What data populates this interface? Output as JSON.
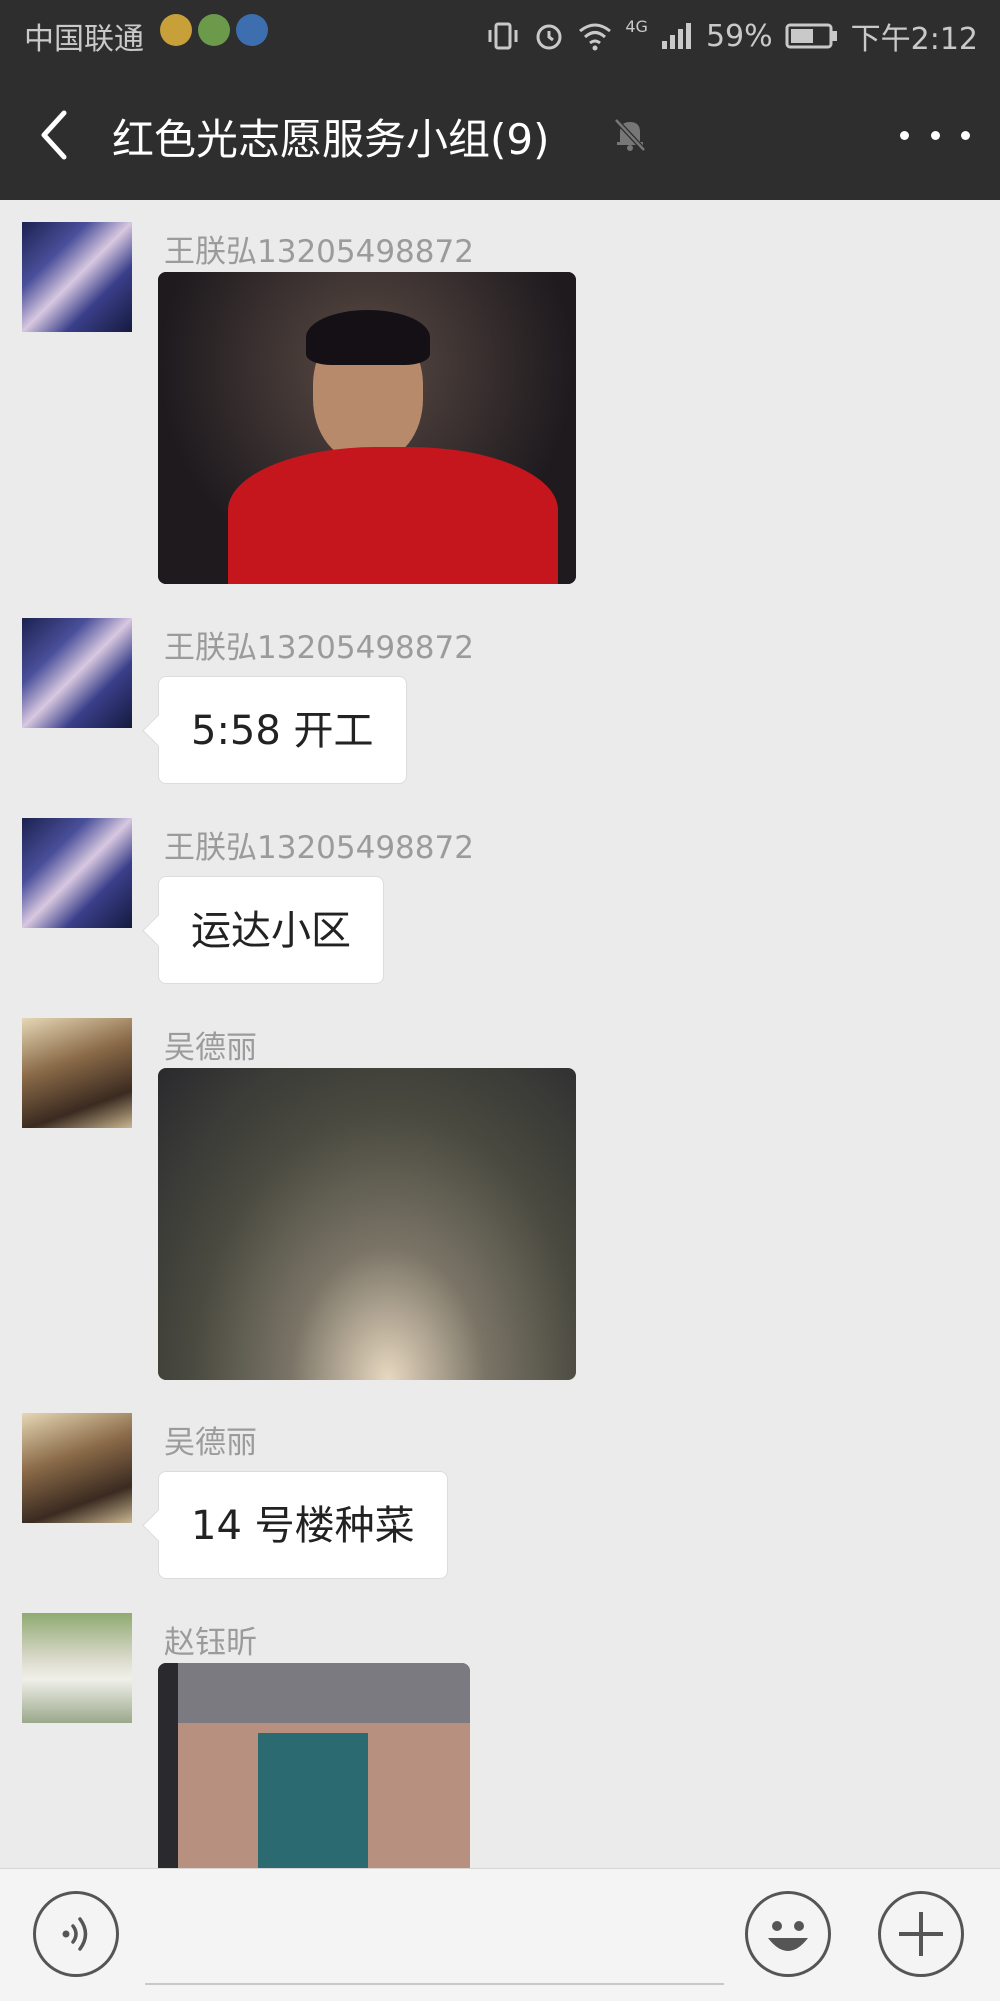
{
  "status_bar": {
    "carrier": "中国联通",
    "network": "4G",
    "battery": "59%",
    "time": "下午2:12"
  },
  "header": {
    "title": "红色光志愿服务小组(9)"
  },
  "messages": [
    {
      "sender": "王朕弘13205498872",
      "type": "image",
      "avatar": "anime-avatar"
    },
    {
      "sender": "王朕弘13205498872",
      "type": "text",
      "text": "5:58 开工",
      "avatar": "anime-avatar"
    },
    {
      "sender": "王朕弘13205498872",
      "type": "text",
      "text": "运达小区",
      "avatar": "anime-avatar"
    },
    {
      "sender": "吴德丽",
      "type": "image",
      "avatar": "couple-avatar"
    },
    {
      "sender": "吴德丽",
      "type": "text",
      "text": "14 号楼种菜",
      "avatar": "couple-avatar"
    },
    {
      "sender": "赵钰昕",
      "type": "image",
      "avatar": "umbrella-avatar"
    }
  ],
  "input_bar": {
    "placeholder": "",
    "icons": [
      "voice-icon",
      "emoji-icon",
      "plus-icon"
    ]
  },
  "colors": {
    "header_bg": "#2e2e2e",
    "chat_bg": "#ebebeb",
    "bubble_bg": "#ffffff",
    "sender_text": "#9b9b9b"
  }
}
